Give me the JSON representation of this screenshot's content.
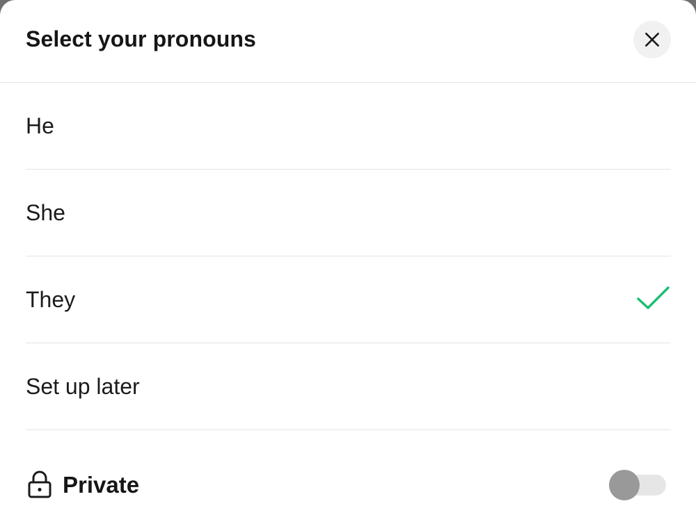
{
  "sheet": {
    "title": "Select your pronouns",
    "close_icon": "close-icon"
  },
  "options": [
    {
      "label": "He",
      "selected": false
    },
    {
      "label": "She",
      "selected": false
    },
    {
      "label": "They",
      "selected": true
    },
    {
      "label": "Set up later",
      "selected": false
    }
  ],
  "private": {
    "label": "Private",
    "icon": "lock-icon",
    "enabled": false
  },
  "colors": {
    "check": "#1dbf73",
    "toggle_thumb": "#999999",
    "toggle_track": "#e6e6e6"
  }
}
